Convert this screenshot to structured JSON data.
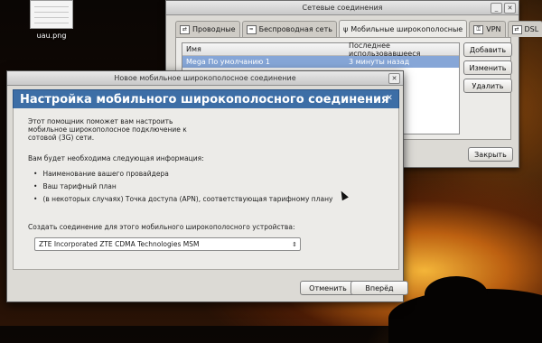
{
  "desktop": {
    "icon_label": "uau.png",
    "icon": "image-file-icon"
  },
  "network_window": {
    "title": "Сетевые соединения",
    "tabs": [
      {
        "label": "Проводные",
        "icon": "wired-icon"
      },
      {
        "label": "Беспроводная сеть",
        "icon": "wireless-icon"
      },
      {
        "label": "Мобильные широкополосные",
        "icon": "mobile-broadband-icon",
        "active": true
      },
      {
        "label": "VPN",
        "icon": "vpn-icon"
      },
      {
        "label": "DSL",
        "icon": "dsl-icon"
      }
    ],
    "list": {
      "columns": [
        "Имя",
        "Последнее использовавшееся"
      ],
      "rows": [
        {
          "name": "Mega По умолчанию 1",
          "last_used": "3 минуты назад"
        }
      ]
    },
    "buttons": {
      "add": "Добавить",
      "edit": "Изменить",
      "delete": "Удалить",
      "close": "Закрыть"
    }
  },
  "wizard": {
    "title": "Новое мобильное широкополосное соединение",
    "header": "Настройка мобильного широкополосного соединения",
    "intro": [
      "Этот помощник поможет вам настроить",
      "мобильное широкополосное подключение к",
      "сотовой (3G) сети."
    ],
    "needed": "Вам будет необходима следующая информация:",
    "bullets": [
      "Наименование вашего провайдера",
      "Ваш тарифный план",
      "(в некоторых случаях) Точка доступа (APN), соответствующая тарифному плану"
    ],
    "device_label": "Создать соединение для этого мобильного широкополосного устройства:",
    "device_value": "ZTE Incorporated ZTE CDMA Technologies MSM",
    "cancel": "Отменить",
    "next": "Вперёд"
  },
  "colors": {
    "header_band": "#3d6ea6",
    "selected_row": "#86a6d7"
  }
}
